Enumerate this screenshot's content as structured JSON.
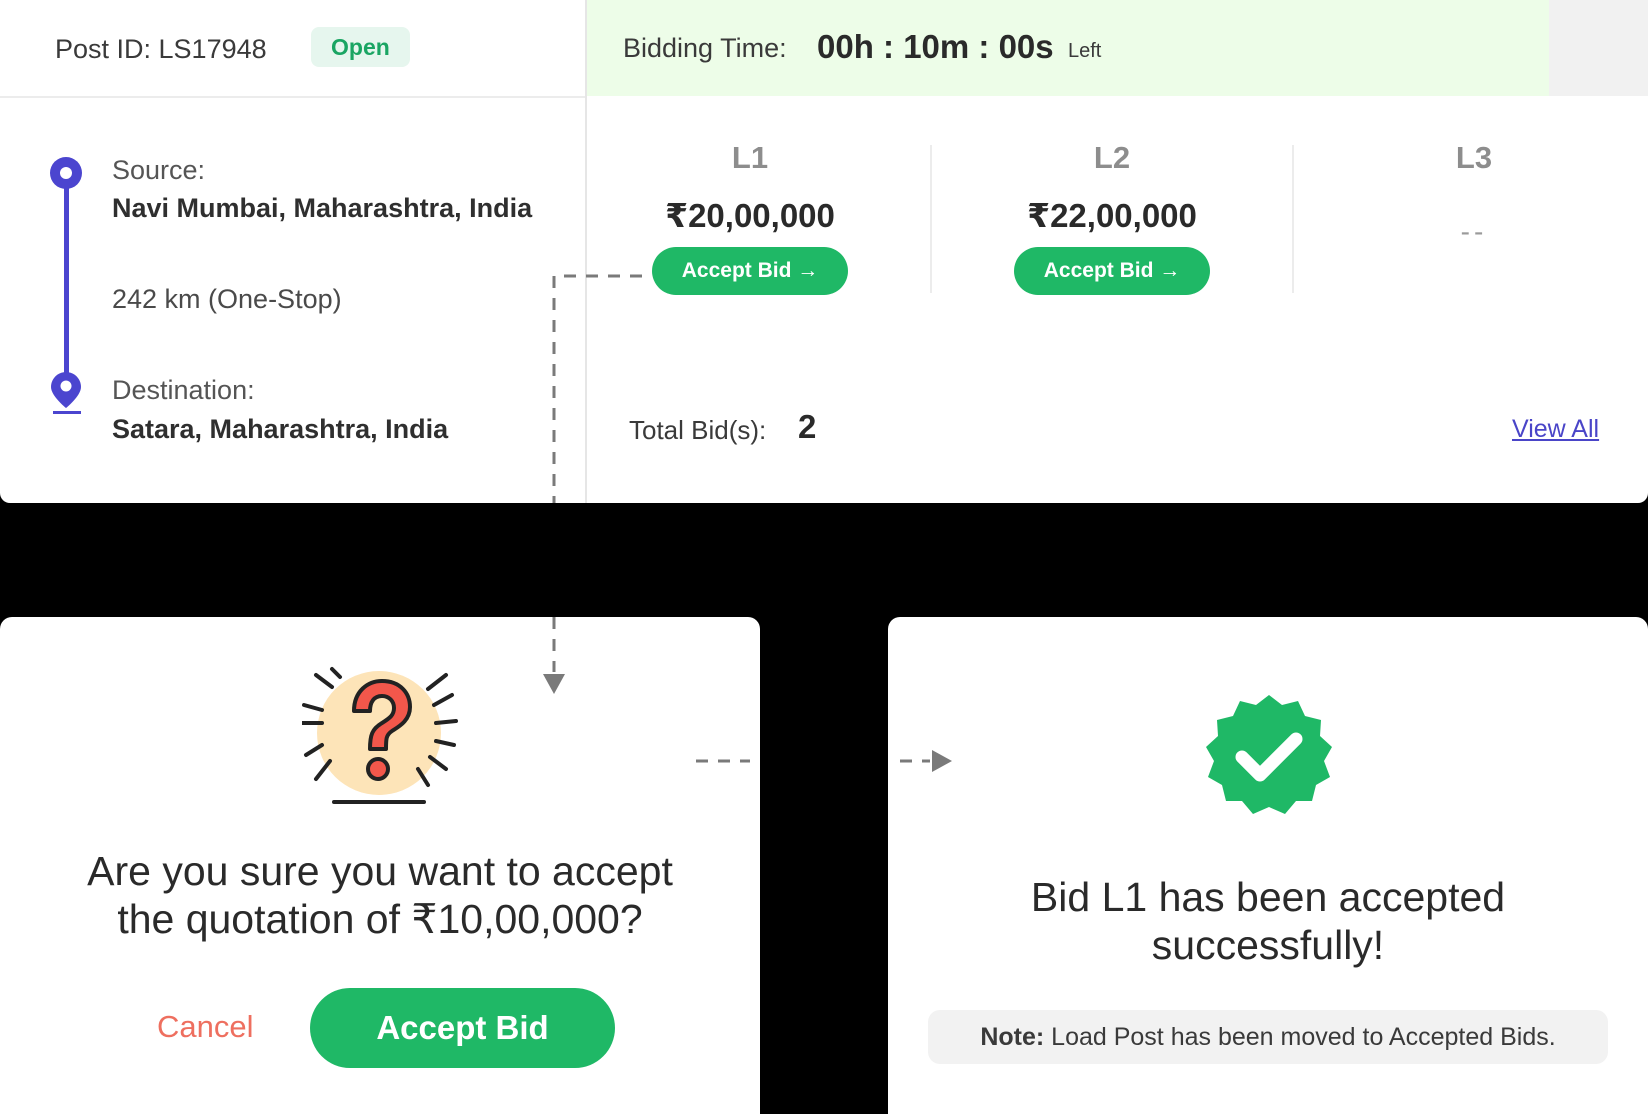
{
  "post": {
    "id_label": "Post ID: LS17948",
    "status": "Open"
  },
  "timer": {
    "label": "Bidding Time:",
    "value": "00h : 10m : 00s",
    "suffix": "Left"
  },
  "route": {
    "source_label": "Source:",
    "source_value": "Navi Mumbai, Maharashtra, India",
    "distance": "242 km (One-Stop)",
    "destination_label": "Destination:",
    "destination_value": "Satara, Maharashtra, India"
  },
  "bids": [
    {
      "rank": "L1",
      "amount": "₹20,00,000",
      "action": "Accept Bid →"
    },
    {
      "rank": "L2",
      "amount": "₹22,00,000",
      "action": "Accept Bid →"
    },
    {
      "rank": "L3",
      "amount": "--"
    }
  ],
  "totals": {
    "label": "Total Bid(s):",
    "value": "2",
    "view_all": "View All"
  },
  "confirm_dialog": {
    "question_line1": "Are you sure you want to accept",
    "question_line2": "the quotation of ₹10,00,000?",
    "cancel": "Cancel",
    "accept": "Accept Bid"
  },
  "success_dialog": {
    "title_line1": "Bid L1 has been accepted",
    "title_line2": "successfully!",
    "note_label": "Note:",
    "note_text": " Load Post has been moved to Accepted Bids."
  },
  "colors": {
    "accent_green": "#1fb866",
    "route_purple": "#4b45cf",
    "timer_bg": "#edfde8",
    "cancel_red": "#ee6f5f"
  },
  "icons": [
    "source-pin-icon",
    "destination-pin-icon",
    "question-mark-icon",
    "verified-badge-icon",
    "arrow-right-icon"
  ]
}
